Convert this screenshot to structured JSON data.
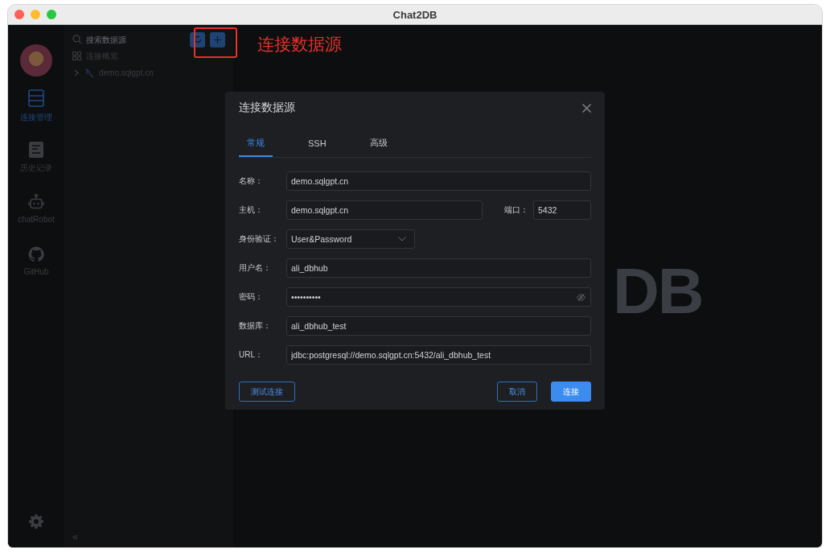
{
  "window": {
    "title": "Chat2DB"
  },
  "nav": {
    "items": [
      {
        "label": "连接管理",
        "selected": true
      },
      {
        "label": "历史记录",
        "selected": false
      },
      {
        "label": "chatRobot",
        "selected": false
      },
      {
        "label": "GitHub",
        "selected": false
      }
    ]
  },
  "tree": {
    "search_placeholder": "搜索数据源",
    "overview": "连接概览",
    "connections": [
      {
        "label": "demo.sqlgpt.cn",
        "expanded": false
      }
    ],
    "collapse": "«"
  },
  "annotation": {
    "text": "连接数据源"
  },
  "background_logo": "DB",
  "dialog": {
    "title": "连接数据源",
    "tabs": [
      {
        "label": "常规",
        "selected": true
      },
      {
        "label": "SSH",
        "selected": false
      },
      {
        "label": "高级",
        "selected": false
      }
    ],
    "fields": [
      {
        "kind": "text",
        "label": "名称：",
        "value": "demo.sqlgpt.cn"
      },
      {
        "kind": "host",
        "label": "主机：",
        "value": "demo.sqlgpt.cn",
        "port_label": "端口：",
        "port_value": "5432"
      },
      {
        "kind": "select",
        "label": "身份验证：",
        "value": "User&Password"
      },
      {
        "kind": "text",
        "label": "用户名：",
        "value": "ali_dbhub"
      },
      {
        "kind": "password",
        "label": "密码：",
        "value": "••••••••••"
      },
      {
        "kind": "text",
        "label": "数据库：",
        "value": "ali_dbhub_test"
      },
      {
        "kind": "text",
        "label": "URL：",
        "value": "jdbc:postgresql://demo.sqlgpt.cn:5432/ali_dbhub_test"
      }
    ],
    "buttons": [
      {
        "label": "测试连接",
        "kind": "outline"
      },
      {
        "label": "取消",
        "kind": "outline"
      },
      {
        "label": "连接",
        "kind": "primary"
      }
    ]
  }
}
